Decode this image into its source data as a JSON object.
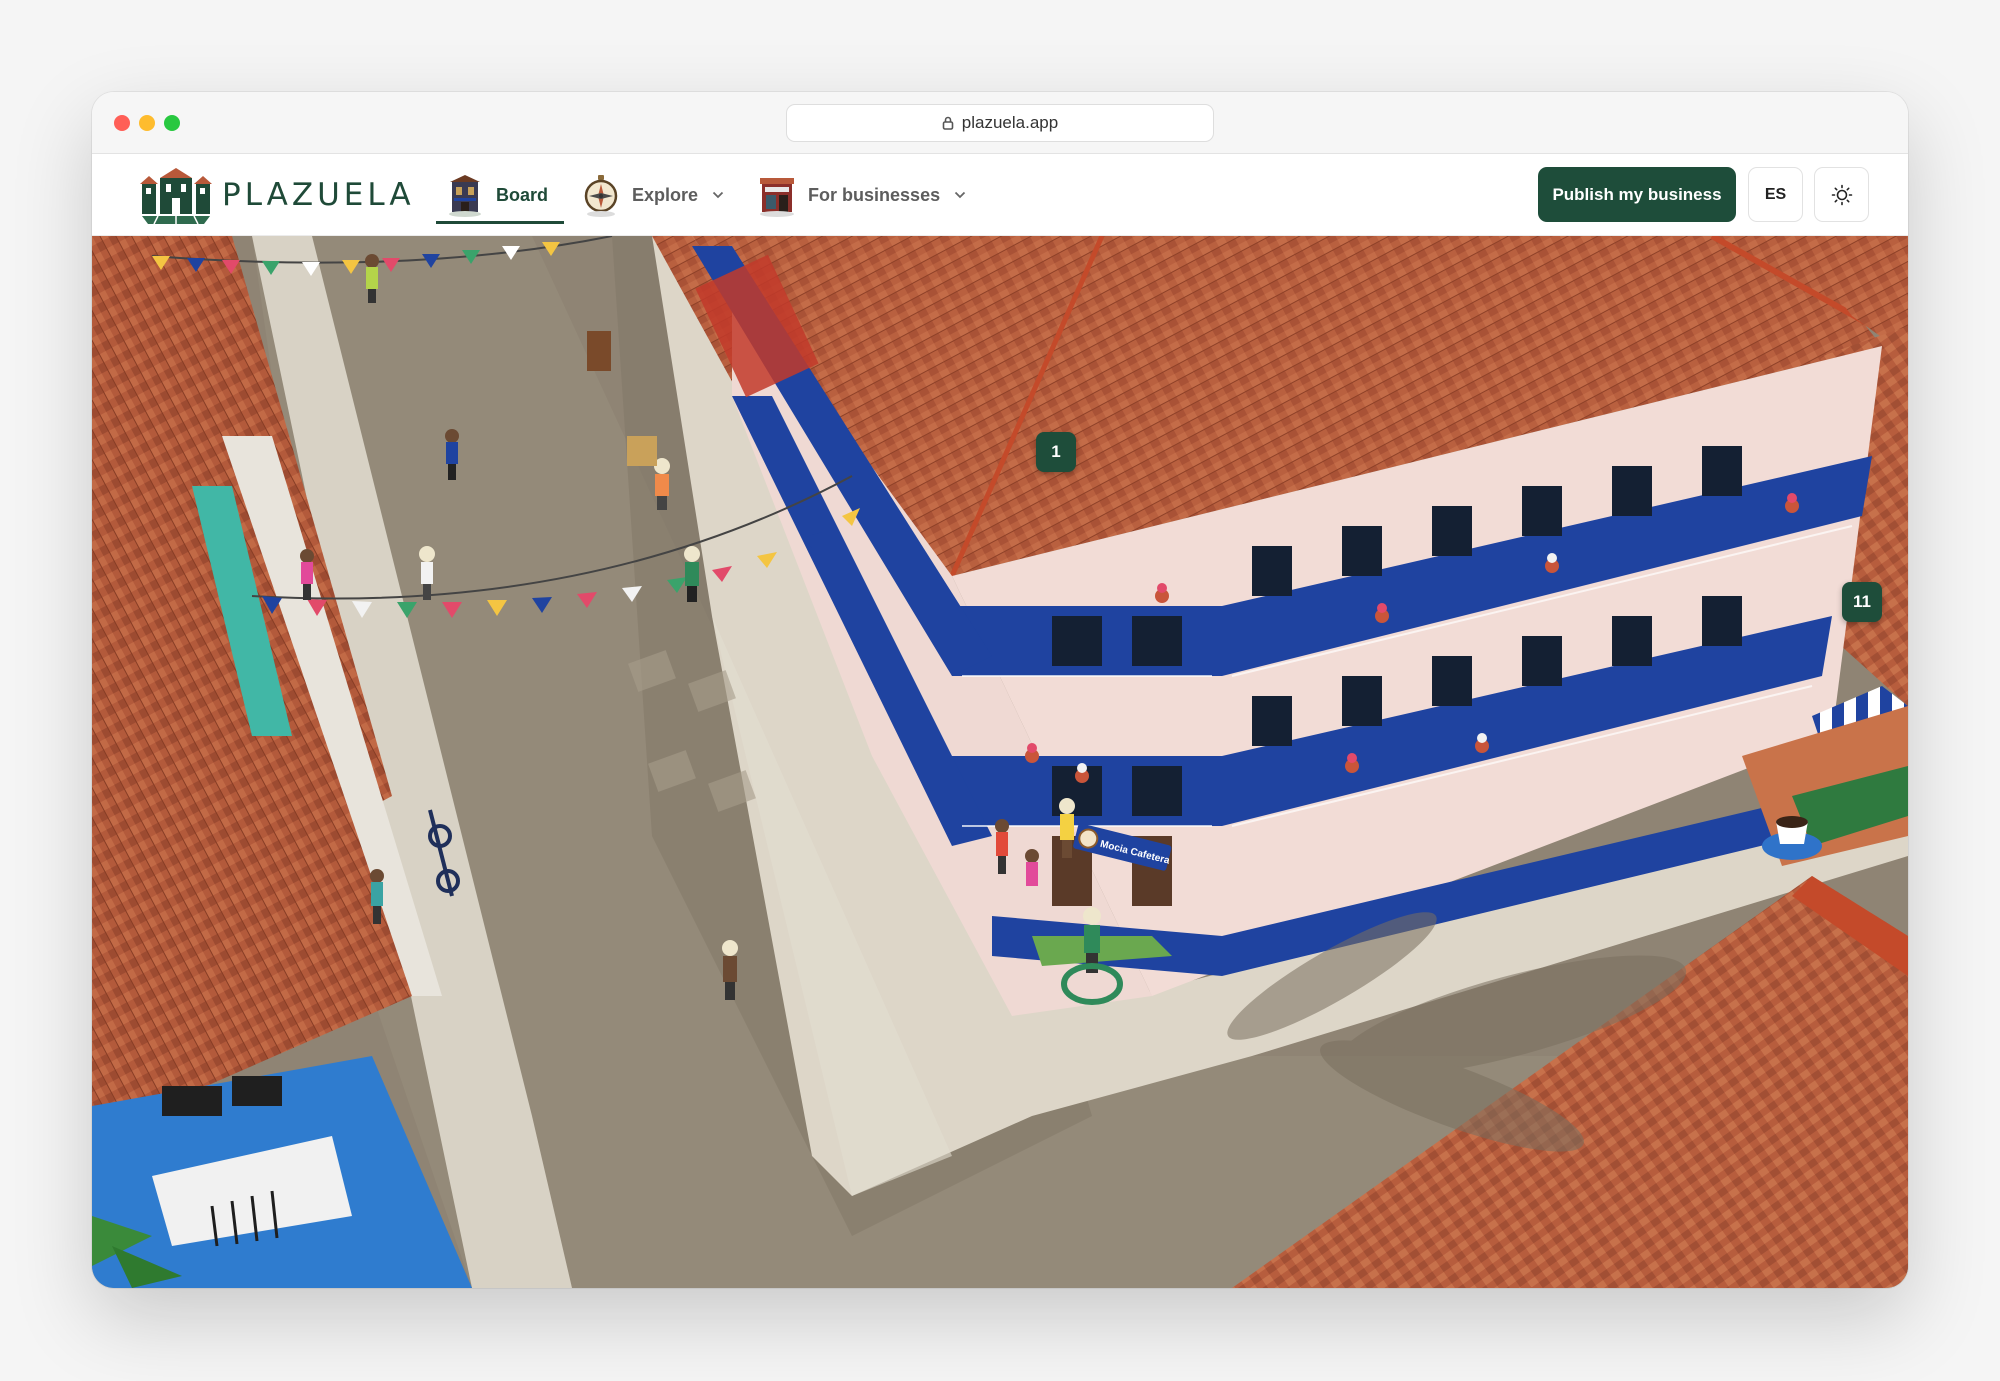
{
  "browser": {
    "url": "plazuela.app"
  },
  "header": {
    "logo_text": "PLAZUELA",
    "nav": [
      {
        "label": "Board",
        "icon": "building-icon",
        "active": true,
        "dropdown": false
      },
      {
        "label": "Explore",
        "icon": "compass-icon",
        "active": false,
        "dropdown": true
      },
      {
        "label": "For businesses",
        "icon": "storefront-icon",
        "active": false,
        "dropdown": true
      }
    ],
    "publish_label": "Publish my business",
    "lang_label": "ES",
    "theme_icon": "sun-icon"
  },
  "map": {
    "markers": [
      {
        "label": "1"
      },
      {
        "label": "11"
      }
    ],
    "shop_sign": "Mocia Cafetera"
  },
  "toolbar": {
    "tools": [
      {
        "name": "rotate-left-icon",
        "active": false
      },
      {
        "name": "rotate-right-icon",
        "active": false
      },
      {
        "name": "zoom-in-icon",
        "active": false
      },
      {
        "name": "zoom-out-icon",
        "active": false
      },
      {
        "name": "swap-icon",
        "active": false
      },
      {
        "name": "walk-icon",
        "active": true
      },
      {
        "name": "home-icon",
        "active": false
      }
    ]
  },
  "colors": {
    "brand": "#1e4d3a",
    "roof": "#b8593a",
    "balcony": "#1f43a0",
    "street": "#8c8170"
  }
}
